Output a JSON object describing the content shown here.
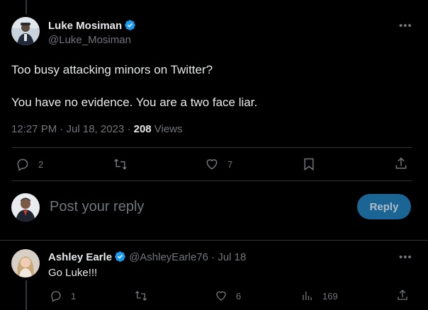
{
  "main_tweet": {
    "author_name": "Luke Mosiman",
    "author_handle": "@Luke_Mosiman",
    "text_line1": "Too busy attacking minors on Twitter?",
    "text_line2": "You have no evidence. You are a two face liar.",
    "time": "12:27 PM · Jul 18, 2023 · ",
    "views_count": "208",
    "views_label": " Views",
    "replies": "2",
    "likes": "7"
  },
  "composer": {
    "placeholder": "Post your reply",
    "reply_button": "Reply"
  },
  "reply_tweet": {
    "author_name": "Ashley Earle",
    "author_handle": "@AshleyEarle76 · Jul 18",
    "text": "Go Luke!!!",
    "replies": "1",
    "likes": "6",
    "views": "169"
  },
  "colors": {
    "verified_blue": "#1d9bf0",
    "accent_button": "#1d6b9e",
    "muted_text": "#71767b"
  },
  "icons": [
    "verified-badge-icon",
    "more-icon",
    "reply-icon",
    "retweet-icon",
    "like-icon",
    "bookmark-icon",
    "share-icon",
    "views-icon"
  ]
}
